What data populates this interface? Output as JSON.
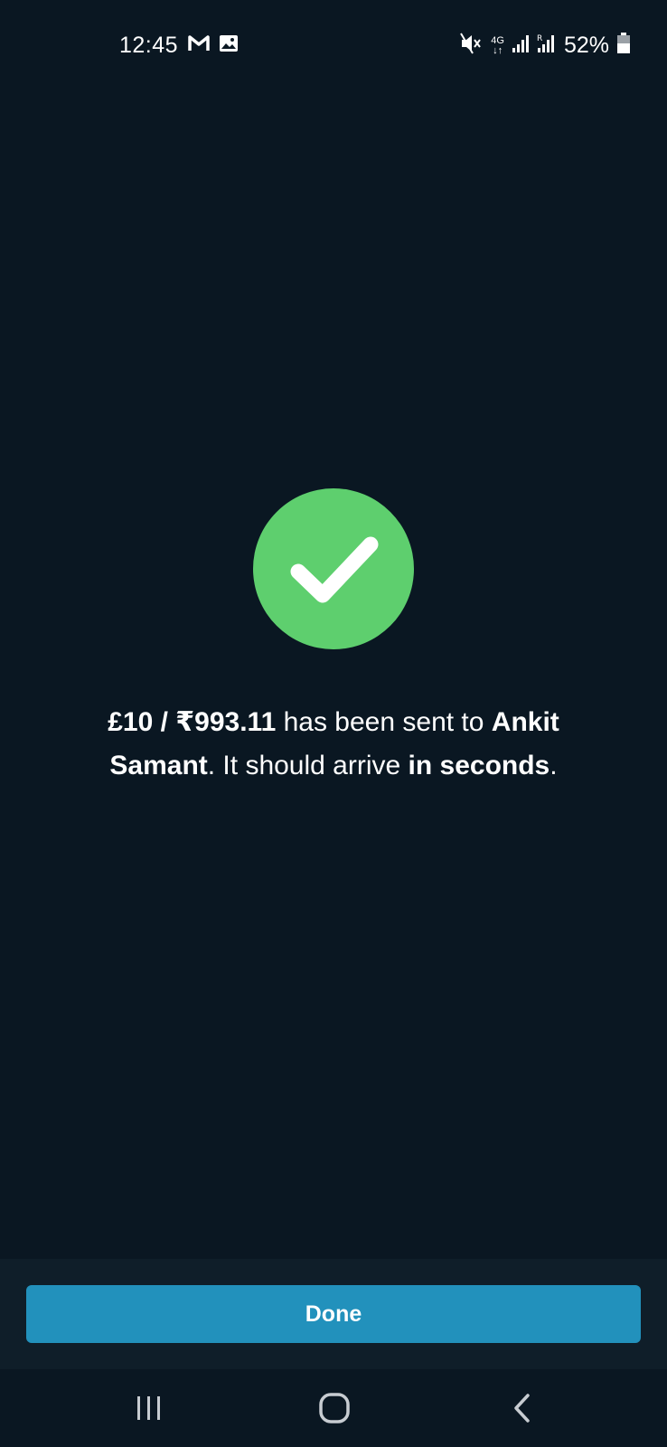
{
  "status_bar": {
    "time": "12:45",
    "network": "4G",
    "battery": "52%",
    "icons": [
      "gmail-icon",
      "gallery-icon",
      "mute-icon",
      "signal-icon",
      "roaming-signal-icon",
      "battery-icon"
    ]
  },
  "success": {
    "icon": "checkmark-icon",
    "icon_color": "#5ecf6e",
    "amount": "£10 / ₹993.11",
    "text_1": " has been sent to ",
    "recipient": "Ankit Samant",
    "text_2": ". It should arrive ",
    "arrival": "in seconds",
    "text_3": "."
  },
  "actions": {
    "done_label": "Done",
    "button_color": "#2291bc"
  },
  "nav": {
    "icons": [
      "recents-icon",
      "home-icon",
      "back-icon"
    ]
  }
}
